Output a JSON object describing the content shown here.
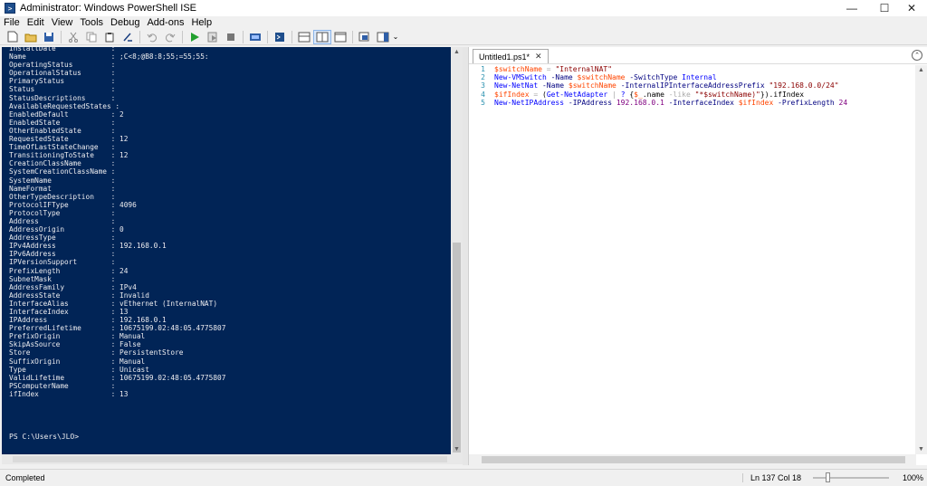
{
  "window": {
    "title": "Administrator: Windows PowerShell ISE",
    "minimize": "—",
    "maximize": "☐",
    "close": "✕"
  },
  "menu": [
    "File",
    "Edit",
    "View",
    "Tools",
    "Debug",
    "Add-ons",
    "Help"
  ],
  "toolbar_icons": [
    "new-file-icon",
    "open-icon",
    "save-icon",
    "cut-icon",
    "copy-icon",
    "paste-icon",
    "clear-console-icon",
    "undo-icon",
    "redo-icon",
    "run-script-icon",
    "run-selection-icon",
    "stop-icon",
    "new-remote-tab-icon",
    "start-powershell-icon",
    "show-script-top-icon",
    "show-script-right-icon",
    "show-script-max-icon",
    "show-command-window-icon",
    "show-command-addon-icon"
  ],
  "console": {
    "lines": [
      "InstallDate             :",
      "Name                    : ;C<8;@B8:8;55;=55;55:",
      "OperatingStatus         :",
      "OperationalStatus       :",
      "PrimaryStatus           :",
      "Status                  :",
      "StatusDescriptions      :",
      "AvailableRequestedStates :",
      "EnabledDefault          : 2",
      "EnabledState            :",
      "OtherEnabledState       :",
      "RequestedState          : 12",
      "TimeOfLastStateChange   :",
      "TransitioningToState    : 12",
      "CreationClassName       :",
      "SystemCreationClassName :",
      "SystemName              :",
      "NameFormat              :",
      "OtherTypeDescription    :",
      "ProtocolIFType          : 4096",
      "ProtocolType            :",
      "Address                 :",
      "AddressOrigin           : 0",
      "AddressType             :",
      "IPv4Address             : 192.168.0.1",
      "IPv6Address             :",
      "IPVersionSupport        :",
      "PrefixLength            : 24",
      "SubnetMask              :",
      "AddressFamily           : IPv4",
      "AddressState            : Invalid",
      "InterfaceAlias          : vEthernet (InternalNAT)",
      "InterfaceIndex          : 13",
      "IPAddress               : 192.168.0.1",
      "PreferredLifetime       : 10675199.02:48:05.4775807",
      "PrefixOrigin            : Manual",
      "SkipAsSource            : False",
      "Store                   : PersistentStore",
      "SuffixOrigin            : Manual",
      "Type                    : Unicast",
      "ValidLifetime           : 10675199.02:48:05.4775807",
      "PSComputerName          :",
      "ifIndex                 : 13"
    ],
    "prompt": "PS C:\\Users\\JLO>"
  },
  "editor": {
    "tab_label": "Untitled1.ps1*",
    "tab_close": "✕",
    "lines": [
      {
        "num": "1",
        "tokens": [
          {
            "t": "$switchName",
            "c": "var"
          },
          {
            "t": " = ",
            "c": "op"
          },
          {
            "t": "\"InternalNAT\"",
            "c": "str"
          }
        ]
      },
      {
        "num": "2",
        "tokens": [
          {
            "t": "New-VMSwitch",
            "c": "cmd"
          },
          {
            "t": " -Name ",
            "c": "param"
          },
          {
            "t": "$switchName",
            "c": "var"
          },
          {
            "t": " -SwitchType ",
            "c": "param"
          },
          {
            "t": "Internal",
            "c": "cmd"
          }
        ]
      },
      {
        "num": "3",
        "tokens": [
          {
            "t": "New-NetNat",
            "c": "cmd"
          },
          {
            "t": " -Name ",
            "c": "param"
          },
          {
            "t": "$switchName",
            "c": "var"
          },
          {
            "t": " -InternalIPInterfaceAddressPrefix ",
            "c": "param"
          },
          {
            "t": "\"192.168.0.0/24\"",
            "c": "str"
          }
        ]
      },
      {
        "num": "4",
        "tokens": [
          {
            "t": "$ifIndex",
            "c": "var"
          },
          {
            "t": " = ",
            "c": "op"
          },
          {
            "t": "(",
            "c": "plain"
          },
          {
            "t": "Get-NetAdapter",
            "c": "cmd"
          },
          {
            "t": " | ",
            "c": "op"
          },
          {
            "t": "? ",
            "c": "cmd"
          },
          {
            "t": "{",
            "c": "plain"
          },
          {
            "t": "$_",
            "c": "var"
          },
          {
            "t": ".name ",
            "c": "plain"
          },
          {
            "t": "-like ",
            "c": "op"
          },
          {
            "t": "\"*$switchName)\"",
            "c": "str"
          },
          {
            "t": "}).ifIndex",
            "c": "plain"
          }
        ]
      },
      {
        "num": "5",
        "tokens": [
          {
            "t": "New-NetIPAddress",
            "c": "cmd"
          },
          {
            "t": " -IPAddress ",
            "c": "param"
          },
          {
            "t": "192.168.0.1",
            "c": "num"
          },
          {
            "t": " -InterfaceIndex ",
            "c": "param"
          },
          {
            "t": "$ifIndex",
            "c": "var"
          },
          {
            "t": " -PrefixLength ",
            "c": "param"
          },
          {
            "t": "24",
            "c": "num"
          }
        ]
      }
    ]
  },
  "status": {
    "text": "Completed",
    "position": "Ln 137  Col 18",
    "zoom": "100%",
    "zoom_level": 0.2
  },
  "colors": {
    "console_bg": "#012456",
    "console_fg": "#eeedf0"
  }
}
